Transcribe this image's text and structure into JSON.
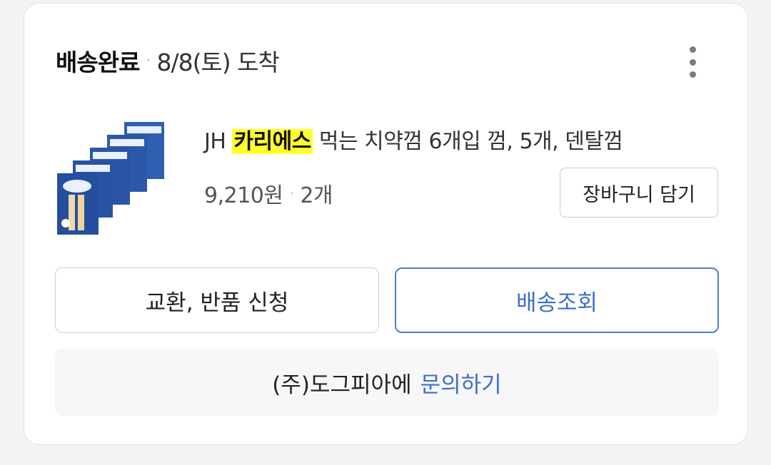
{
  "order": {
    "status": "배송완료",
    "separator": "·",
    "arrival": "8/8(토) 도착"
  },
  "product": {
    "name_prefix": "JH",
    "name_highlight": "카리에스",
    "name_suffix": "먹는 치약껌 6개입 껌, 5개, 덴탈껌",
    "price": "9,210원",
    "quantity": "2개",
    "image_icon": "product-thumbnail"
  },
  "buttons": {
    "cart": "장바구니 담기",
    "exchange_return": "교환, 반품 신청",
    "track_delivery": "배송조회"
  },
  "inquiry": {
    "seller": "(주)도그피아에",
    "link": "문의하기"
  },
  "colors": {
    "accent_blue": "#3d6fc9",
    "highlight_yellow": "#ffff2e",
    "card_background": "#ffffff"
  },
  "icons": {
    "more": "more-vertical-icon"
  }
}
